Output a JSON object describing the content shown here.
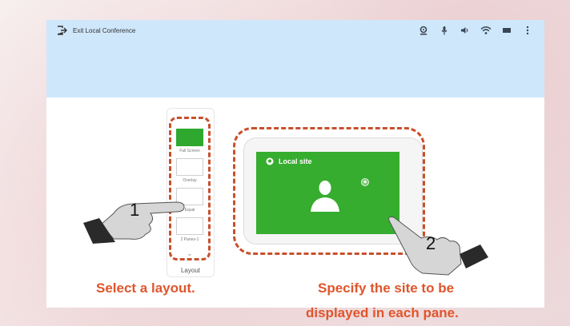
{
  "topbar": {
    "exit_label": "Exit Local Conference",
    "status_icons": [
      "camera-icon",
      "microphone-icon",
      "speaker-icon",
      "wifi-icon",
      "battery-icon",
      "more-icon"
    ]
  },
  "layout_panel": {
    "items": [
      "Full Screen",
      "Overlay",
      "Equal",
      "2 Panes-1"
    ],
    "caption": "Layout"
  },
  "local_site": {
    "label": "Local site"
  },
  "callouts": {
    "one": "1",
    "two": "2"
  },
  "captions": {
    "select_layout": "Select a layout.",
    "specify_site_line1": "Specify the site to be",
    "specify_site_line2": "displayed in each pane."
  },
  "colors": {
    "accent_dash": "#c8502d",
    "caption_orange": "#e0552b",
    "site_green": "#36ad2e",
    "topbar_blue": "#cfe7fb"
  }
}
